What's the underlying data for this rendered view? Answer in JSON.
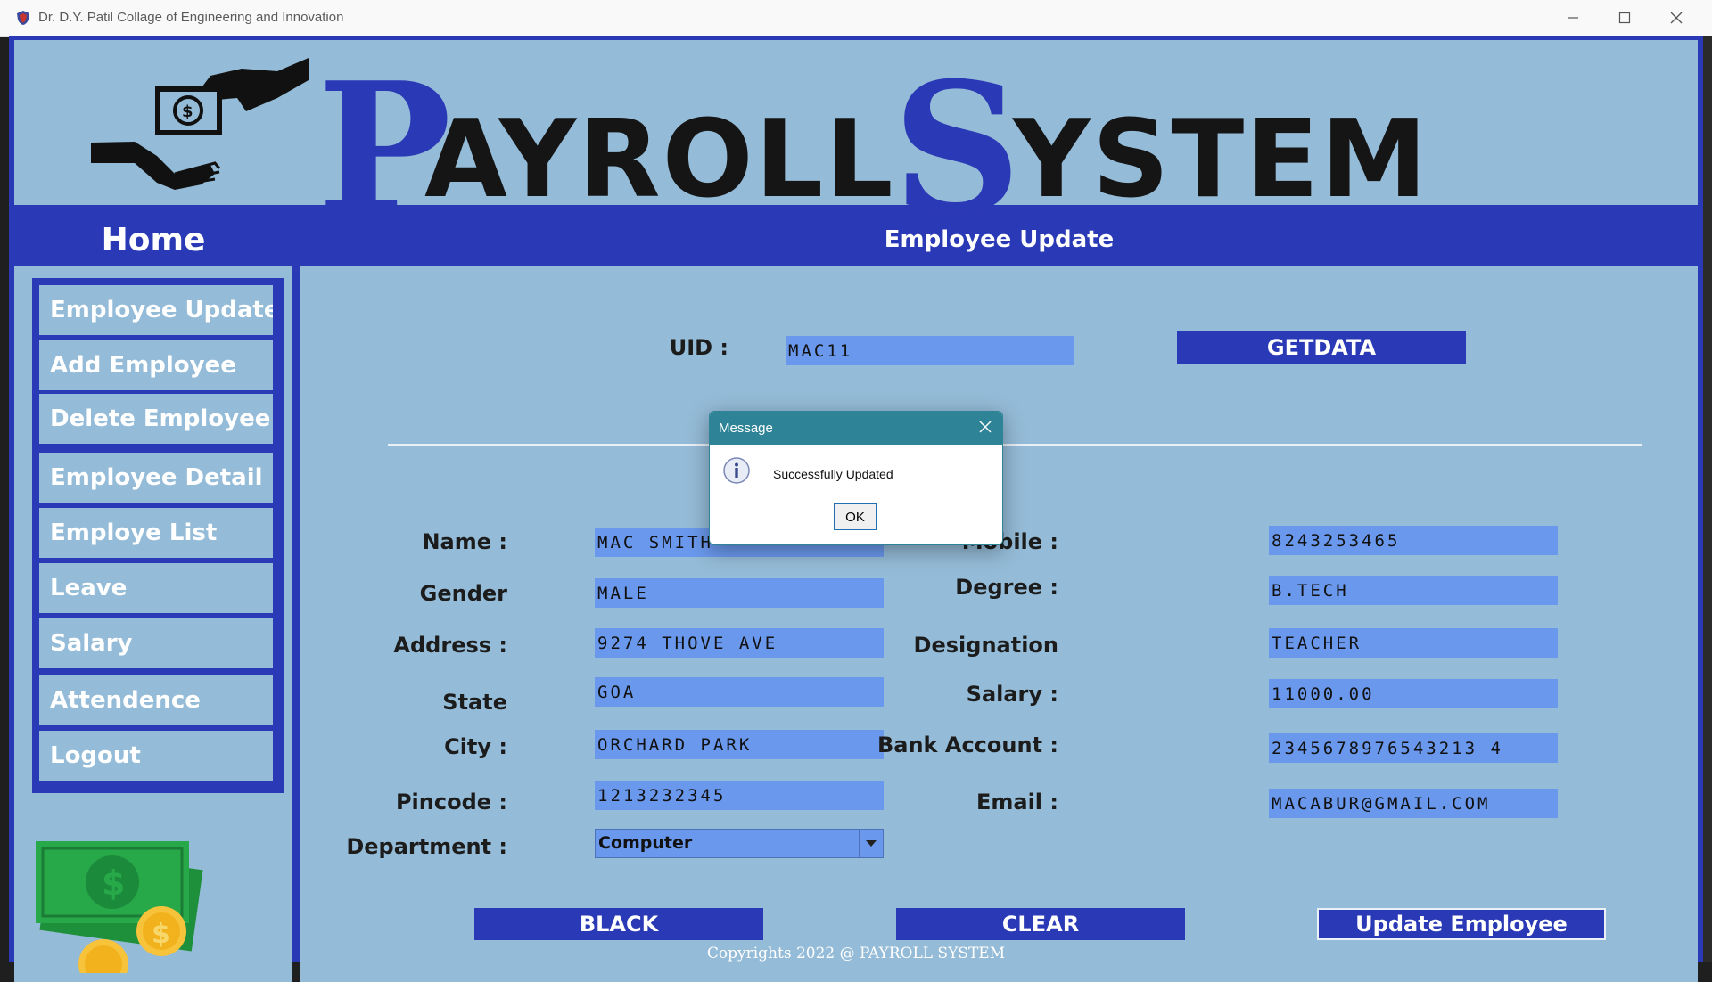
{
  "window": {
    "title": "Dr. D.Y. Patil Collage of Engineering and Innovation",
    "minimize_icon": "minimize-icon",
    "maximize_icon": "maximize-icon",
    "close_icon": "close-icon"
  },
  "header": {
    "first_initial": "P",
    "first_rest": "AYROLL",
    "second_initial": "S",
    "second_rest": "YSTEM",
    "logo_icon": "money-hands-icon"
  },
  "sidebar": {
    "title": "Home",
    "items": [
      {
        "label": "Employee Update"
      },
      {
        "label": "Add Employee"
      },
      {
        "label": "Delete Employee"
      },
      {
        "label": "Employee Detail"
      },
      {
        "label": "Employe List"
      },
      {
        "label": "Leave"
      },
      {
        "label": "Salary"
      },
      {
        "label": "Attendence"
      },
      {
        "label": "Logout"
      }
    ],
    "illustration_icon": "cash-coins-icon"
  },
  "main": {
    "title": "Employee Update",
    "uid_label": "UID :",
    "uid_value": "MAC11",
    "getdata_label": "GETDATA",
    "fields": {
      "name": {
        "label": "Name :",
        "value": "MAC SMITH"
      },
      "gender": {
        "label": "Gender",
        "value": "MALE"
      },
      "address": {
        "label": "Address :",
        "value": "9274 THOVE AVE"
      },
      "state": {
        "label": "State",
        "value": "GOA"
      },
      "city": {
        "label": "City :",
        "value": "ORCHARD PARK"
      },
      "pincode": {
        "label": "Pincode :",
        "value": "1213232345"
      },
      "department": {
        "label": "Department :",
        "value": "Computer"
      },
      "mobile": {
        "label": "Mobile :",
        "value": "8243253465"
      },
      "degree": {
        "label": "Degree :",
        "value": "B.TECH"
      },
      "designation": {
        "label": "Designation",
        "value": "TEACHER"
      },
      "salary": {
        "label": "Salary :",
        "value": "11000.00"
      },
      "bank_account": {
        "label": "Bank Account :",
        "value": "2345678976543213 4"
      },
      "email": {
        "label": "Email :",
        "value": "MACABUR@GMAIL.COM"
      }
    },
    "buttons": {
      "back": "BLACK",
      "clear": "CLEAR",
      "update": "Update Employee"
    }
  },
  "dialog": {
    "title": "Message",
    "message": "Successfully Updated",
    "ok_label": "OK",
    "icon": "info-icon"
  },
  "footer": {
    "text": "Copyrights 2022 @ PAYROLL SYSTEM"
  },
  "colors": {
    "primary_blue": "#2a39b5",
    "panel_bg": "#94bbd7",
    "field_bg": "#6a98ec",
    "dialog_title": "#2e8396"
  }
}
